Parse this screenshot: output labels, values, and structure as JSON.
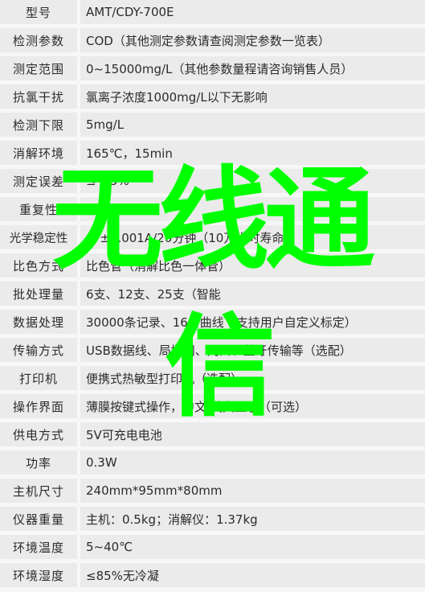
{
  "spec_table": {
    "rows": [
      {
        "label": "型号",
        "value": "AMT/CDY-700E"
      },
      {
        "label": "检测参数",
        "value": "COD（其他测定参数请查阅测定参数一览表）"
      },
      {
        "label": "测定范围",
        "value": "0~15000mg/L（其他参数量程请咨询销售人员）"
      },
      {
        "label": "抗氯干扰",
        "value": "氯离子浓度1000mg/L以下无影响"
      },
      {
        "label": "检测下限",
        "value": "5mg/L"
      },
      {
        "label": "消解环境",
        "value": "165℃，15min"
      },
      {
        "label": "测定误差",
        "value": "≤ ±5%"
      },
      {
        "label": "重复性",
        "value": "≤ ±5%"
      },
      {
        "label": "光学稳定性",
        "value": "≤ ±0.001A/20分钟（10万小时寿命"
      },
      {
        "label": "比色方式",
        "value": "比色管（消解比色一体管）"
      },
      {
        "label": "批处理量",
        "value": "6支、12支、25支（智能"
      },
      {
        "label": "数据处理",
        "value": "30000条记录、16条曲线（支持用户自定义标定）"
      },
      {
        "label": "传输方式",
        "value": "USB数据线、局域网、网口、蓝牙传输等（选配）"
      },
      {
        "label": "打印机",
        "value": "便携式热敏型打印机（选配）"
      },
      {
        "label": "操作界面",
        "value": "薄膜按键式操作，中文/英文显示（可选）"
      },
      {
        "label": "供电方式",
        "value": "5V可充电电池"
      },
      {
        "label": "功率",
        "value": "0.3W"
      },
      {
        "label": "主机尺寸",
        "value": "240mm*95mm*80mm"
      },
      {
        "label": "仪器重量",
        "value": "主机：0.5kg；消解仪：1.37kg"
      },
      {
        "label": "环境温度",
        "value": "5~40℃"
      },
      {
        "label": "环境湿度",
        "value": "≤85%无冷凝"
      }
    ]
  },
  "watermark": {
    "line1": "无线通",
    "line2": "信",
    "color": "#00ff00"
  }
}
